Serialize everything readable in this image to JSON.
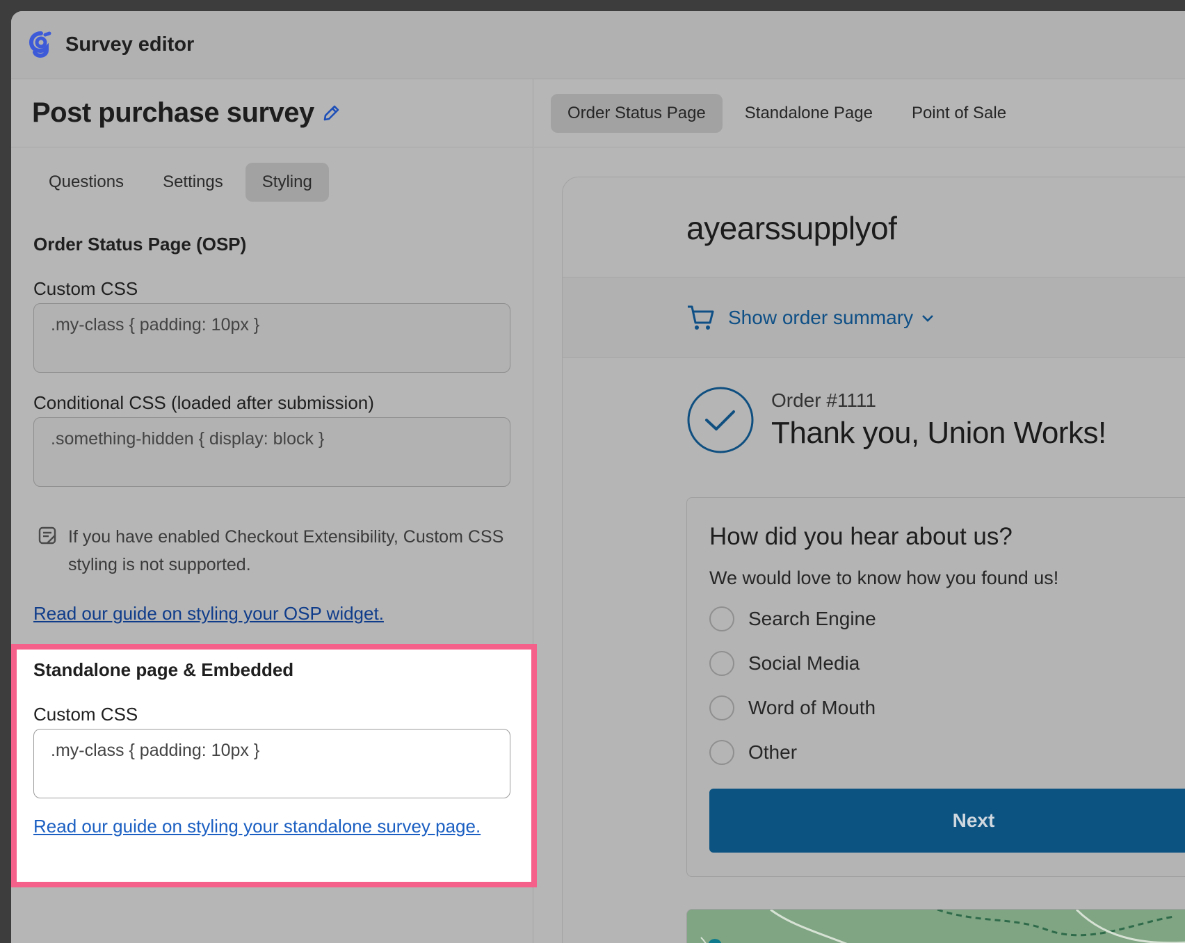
{
  "app": {
    "title": "Survey editor"
  },
  "survey": {
    "title": "Post purchase survey"
  },
  "editor_tabs": [
    {
      "label": "Questions",
      "active": false
    },
    {
      "label": "Settings",
      "active": false
    },
    {
      "label": "Styling",
      "active": true
    }
  ],
  "osp": {
    "heading": "Order Status Page (OSP)",
    "custom_css_label": "Custom CSS",
    "custom_css_placeholder": ".my-class { padding: 10px }",
    "conditional_css_label": "Conditional CSS (loaded after submission)",
    "conditional_css_placeholder": ".something-hidden { display: block }",
    "note": "If you have enabled Checkout Extensibility, Custom CSS styling is not supported.",
    "guide_link": "Read our guide on styling your OSP widget."
  },
  "standalone": {
    "heading": "Standalone page & Embedded",
    "custom_css_label": "Custom CSS",
    "custom_css_placeholder": ".my-class { padding: 10px }",
    "guide_link": "Read our guide on styling your standalone survey page."
  },
  "channel_tabs": [
    {
      "label": "Order Status Page",
      "active": true
    },
    {
      "label": "Standalone Page",
      "active": false
    },
    {
      "label": "Point of Sale",
      "active": false
    }
  ],
  "preview": {
    "shop_name": "ayearssupplyof",
    "order_summary": "Show order summary",
    "order_number": "Order #1111",
    "thank_you": "Thank you, Union Works!",
    "question": "How did you hear about us?",
    "subtitle": "We would love to know how you found us!",
    "options": [
      "Search Engine",
      "Social Media",
      "Word of Mouth",
      "Other"
    ],
    "next_label": "Next"
  },
  "colors": {
    "highlight_border": "#f4608a",
    "link": "#0f3c8a",
    "brand_primary": "#0c5382"
  },
  "icons": {
    "logo": "app-logo-g",
    "edit": "pencil-icon",
    "note": "note-icon",
    "cart": "cart-icon",
    "chevron": "chevron-down-icon",
    "check": "check-circle-icon"
  }
}
